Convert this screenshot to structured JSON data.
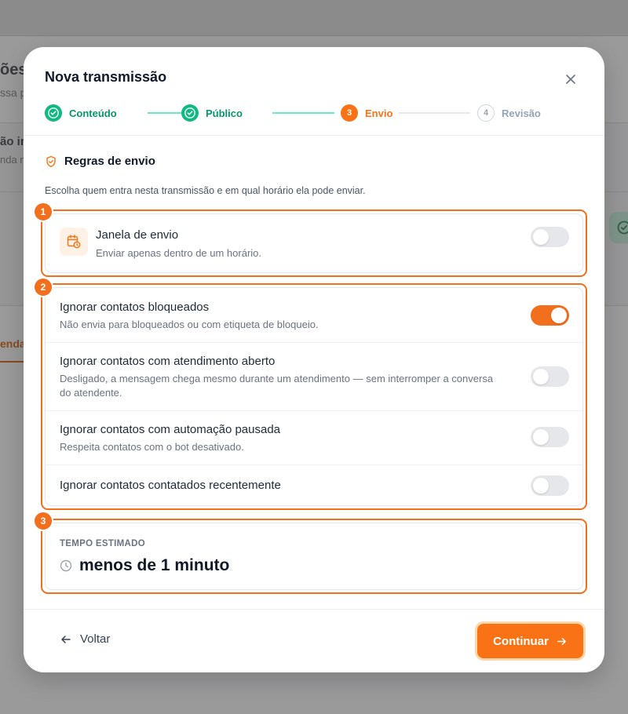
{
  "background": {
    "title": "ões",
    "subtitle": "ssa p",
    "card_title": "ão in",
    "card_sub": "nda n",
    "tab": "enda"
  },
  "modal": {
    "title": "Nova transmissão",
    "close_icon": "close-icon"
  },
  "stepper": {
    "steps": [
      {
        "label": "Conteúdo",
        "state": "done",
        "number": ""
      },
      {
        "label": "Público",
        "state": "done",
        "number": ""
      },
      {
        "label": "Envio",
        "state": "active",
        "number": "3"
      },
      {
        "label": "Revisão",
        "state": "todo",
        "number": "4"
      }
    ]
  },
  "section": {
    "title": "Regras de envio",
    "description": "Escolha quem entra nesta transmissão e em qual horário ela pode enviar.",
    "icon": "shield-check-icon"
  },
  "highlights": {
    "badge_1": "1",
    "badge_2": "2",
    "badge_3": "3"
  },
  "window_rule": {
    "title": "Janela de envio",
    "subtitle": "Enviar apenas dentro de um horário.",
    "icon": "calendar-clock-icon",
    "enabled": false
  },
  "rules": [
    {
      "title": "Ignorar contatos bloqueados",
      "subtitle": "Não envia para bloqueados ou com etiqueta de bloqueio.",
      "enabled": true
    },
    {
      "title": "Ignorar contatos com atendimento aberto",
      "subtitle_line1": "Desligado, a mensagem chega mesmo durante um atendimento — sem interromper a conversa",
      "subtitle_line2": "do atendente.",
      "enabled": false
    },
    {
      "title": "Ignorar contatos com automação pausada",
      "subtitle": "Respeita contatos com o bot desativado.",
      "enabled": false
    },
    {
      "title": "Ignorar contatos contatados recentemente",
      "enabled": false
    }
  ],
  "estimate": {
    "label": "TEMPO ESTIMADO",
    "value": "menos de 1 minuto",
    "icon": "clock-icon"
  },
  "footer": {
    "back_label": "Voltar",
    "continue_label": "Continuar"
  },
  "colors": {
    "accent": "#f97316",
    "success": "#10b981",
    "highlight": "#f26f1d"
  }
}
